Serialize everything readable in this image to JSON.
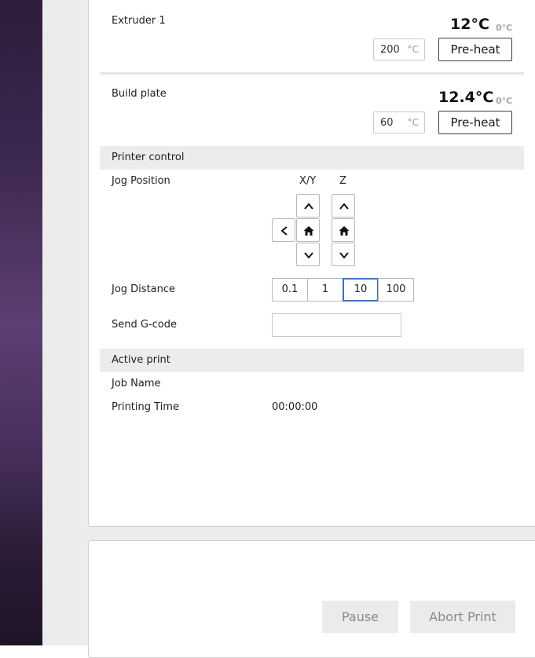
{
  "extruder": {
    "label": "Extruder 1",
    "current_temp": "12°C",
    "target_temp": "0°C",
    "input_value": "200",
    "input_unit": "°C",
    "preheat_label": "Pre-heat"
  },
  "build_plate": {
    "label": "Build plate",
    "current_temp": "12.4°C",
    "target_temp": "0°C",
    "input_value": "60",
    "input_unit": "°C",
    "preheat_label": "Pre-heat"
  },
  "printer_control": {
    "section_title": "Printer control",
    "jog_position_label": "Jog Position",
    "xy_label": "X/Y",
    "z_label": "Z",
    "jog_distance_label": "Jog Distance",
    "jog_distances": [
      "0.1",
      "1",
      "10",
      "100"
    ],
    "selected_distance": "10",
    "send_gcode_label": "Send G-code",
    "send_gcode_value": ""
  },
  "active_print": {
    "section_title": "Active print",
    "job_name_label": "Job Name",
    "job_name_value": "",
    "printing_time_label": "Printing Time",
    "printing_time_value": "00:00:00"
  },
  "actions": {
    "pause_label": "Pause",
    "abort_label": "Abort Print"
  },
  "colors": {
    "accent": "#3a6fd8",
    "section_bg": "#ececec",
    "disabled_button_bg": "#ebebeb"
  }
}
